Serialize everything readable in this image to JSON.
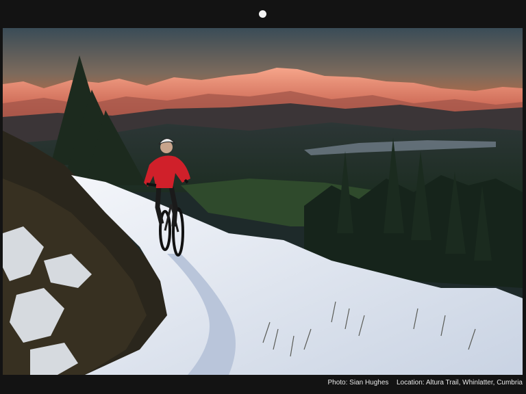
{
  "caption": {
    "photo_label": "Photo:",
    "photographer": "Sian Hughes",
    "location_label": "Location:",
    "location": "Altura Trail, Whinlatter, Cumbria"
  },
  "colors": {
    "sky_top": "#3c4d56",
    "sky_horizon": "#c96a3f",
    "mountain_glow": "#f08a6a",
    "snow": "#eef2f6",
    "jacket": "#d0202a"
  },
  "icons": {
    "camera": "camera-dot-icon"
  }
}
